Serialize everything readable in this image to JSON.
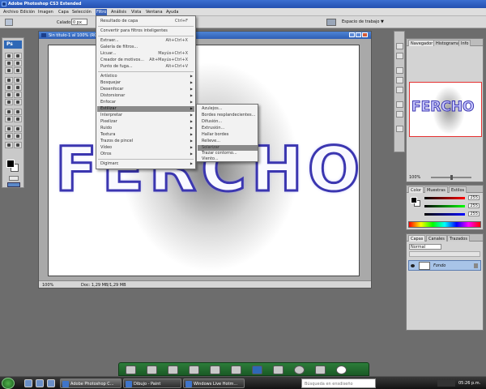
{
  "titlebar": {
    "title": "Adobe Photoshop CS3 Extended"
  },
  "menubar": {
    "items": [
      "Archivo",
      "Edición",
      "Imagen",
      "Capa",
      "Selección",
      "Filtro",
      "Análisis",
      "Vista",
      "Ventana",
      "Ayuda"
    ],
    "active": "Filtro"
  },
  "options": {
    "feather_label": "Calado:",
    "feather_value": "0 px",
    "workspace": "Espacio de trabajo ▼"
  },
  "document": {
    "title": "Sin título-1 al 100% (RGB/8)",
    "zoom": "100%",
    "doc_size": "Doc: 1,29 MB/1,29 MB",
    "canvas_text": "FERCHO"
  },
  "filter_menu": {
    "items": [
      {
        "label": "Resultado de capa",
        "shortcut": "Ctrl+F"
      },
      {
        "label": "Convertir para filtros inteligentes",
        "shortcut": ""
      },
      {
        "label": "Extraer...",
        "shortcut": "Alt+Ctrl+X"
      },
      {
        "label": "Galería de filtros...",
        "shortcut": ""
      },
      {
        "label": "Licuar...",
        "shortcut": "Mayús+Ctrl+X"
      },
      {
        "label": "Creador de motivos...",
        "shortcut": "Alt+Mayús+Ctrl+X"
      },
      {
        "label": "Punto de fuga...",
        "shortcut": "Alt+Ctrl+V"
      },
      {
        "label": "Artístico",
        "shortcut": ""
      },
      {
        "label": "Bosquejar",
        "shortcut": ""
      },
      {
        "label": "Desenfocar",
        "shortcut": ""
      },
      {
        "label": "Distorsionar",
        "shortcut": ""
      },
      {
        "label": "Enfocar",
        "shortcut": ""
      },
      {
        "label": "Estilizar",
        "shortcut": ""
      },
      {
        "label": "Interpretar",
        "shortcut": ""
      },
      {
        "label": "Pixelizar",
        "shortcut": ""
      },
      {
        "label": "Ruido",
        "shortcut": ""
      },
      {
        "label": "Textura",
        "shortcut": ""
      },
      {
        "label": "Trazos de pincel",
        "shortcut": ""
      },
      {
        "label": "Vídeo",
        "shortcut": ""
      },
      {
        "label": "Otros",
        "shortcut": ""
      },
      {
        "label": "Digimarc",
        "shortcut": ""
      }
    ],
    "highlighted": "Estilizar"
  },
  "submenu": {
    "items": [
      "Azulejos...",
      "Bordes resplandecientes...",
      "Difusión...",
      "Extrusión...",
      "Hallar bordes",
      "Relieve...",
      "Solarizar",
      "Trazar contorno...",
      "Viento..."
    ],
    "highlighted": "Solarizar"
  },
  "panels": {
    "navigator_tabs": [
      "Navegador",
      "Histograma",
      "Info"
    ],
    "navigator_zoom": "100%",
    "thumbnail_text": "FERCHO",
    "color_tabs": [
      "Color",
      "Muestras",
      "Estilos"
    ],
    "color_values": [
      "255",
      "255",
      "255"
    ],
    "layers_tabs": [
      "Capas",
      "Canales",
      "Trazados"
    ],
    "blend_mode": "Normal",
    "layer_name": "Fondo"
  },
  "taskbar": {
    "tasks": [
      "Adobe Photoshop C...",
      "Dibujo - Paint",
      "Windows Live Hotm..."
    ],
    "search_placeholder": "Búsqueda en ensdiseño",
    "clock": "05:26 p.m."
  },
  "colors": {
    "accent": "#3a63b8",
    "text_stroke": "#3b36b0"
  }
}
